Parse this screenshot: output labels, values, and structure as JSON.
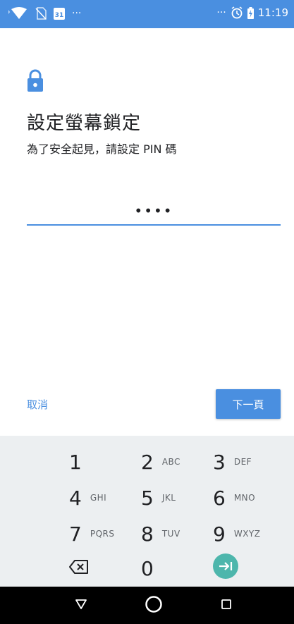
{
  "status_bar": {
    "left_icons": [
      "wifi-icon",
      "no-sim-icon",
      "calendar-icon",
      "more-notifications-icon"
    ],
    "calendar_day": "31",
    "more_left": "···",
    "more_right": "···",
    "right_icons": [
      "alarm-icon",
      "battery-charging-icon"
    ],
    "time": "11:19",
    "color": "#4a8fe0"
  },
  "screen": {
    "icon": "lock-icon",
    "title": "設定螢幕鎖定",
    "subtitle": "為了安全起見，請設定 PIN 碼"
  },
  "pin": {
    "value": "••••"
  },
  "actions": {
    "cancel_label": "取消",
    "next_label": "下一頁"
  },
  "keypad": {
    "keys": [
      {
        "digit": "1",
        "letters": ""
      },
      {
        "digit": "2",
        "letters": "ABC"
      },
      {
        "digit": "3",
        "letters": "DEF"
      },
      {
        "digit": "4",
        "letters": "GHI"
      },
      {
        "digit": "5",
        "letters": "JKL"
      },
      {
        "digit": "6",
        "letters": "MNO"
      },
      {
        "digit": "7",
        "letters": "PQRS"
      },
      {
        "digit": "8",
        "letters": "TUV"
      },
      {
        "digit": "9",
        "letters": "WXYZ"
      },
      {
        "digit": "0",
        "letters": ""
      }
    ],
    "backspace_icon": "backspace-icon",
    "enter_icon": "enter-icon",
    "enter_color": "#4db6ac"
  },
  "nav_bar": {
    "icons": [
      "back-icon",
      "home-icon",
      "recents-icon"
    ]
  }
}
